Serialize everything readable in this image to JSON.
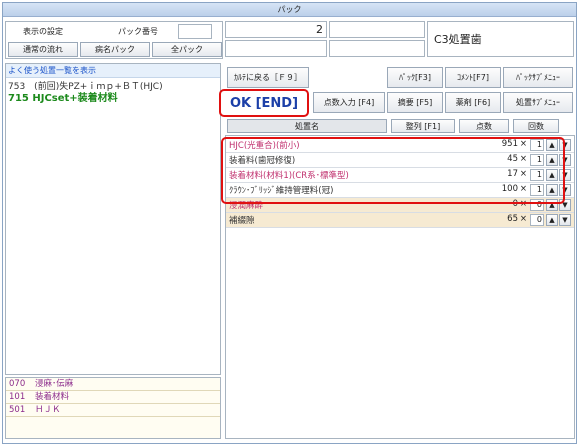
{
  "window": {
    "title": "パック"
  },
  "top_left": {
    "btn_display_settings": "表示の設定",
    "pack_number_label": "パック番号",
    "pack_number_value": "",
    "btn_normal_flow": "通常の流れ",
    "btn_disease_pack": "病名パック",
    "btn_all_pack": "全パック"
  },
  "top_right": {
    "count_value": "2",
    "pack_name": "C3処置歯"
  },
  "frequent_list": {
    "header": "よく使う処置一覧を表示",
    "items": [
      {
        "text": "753　(前回)失PZ+ｉｍｐ+ＢＴ(HJC)"
      },
      {
        "text": "715 HJCset+装着材料"
      }
    ]
  },
  "bottom_list": [
    {
      "code": "070",
      "name": "浸麻･伝麻"
    },
    {
      "code": "101",
      "name": "装着材料"
    },
    {
      "code": "501",
      "name": "ＨＪＫ"
    }
  ],
  "toolbar": {
    "return_chart": "ｶﾙﾃに戻る［Ｆ９］",
    "pack_f3": "ﾊﾟｯｸ[F3]",
    "comment_f7": "ｺﾒﾝﾄ[F7]",
    "pack_submenu": "ﾊﾟｯｸｻﾌﾞﾒﾆｭｰ",
    "ok_end": "OK [END]",
    "points_input": "点数入力 [F4]",
    "summary_f5": "摘要 [F5]",
    "drug_f6": "薬剤 [F6]",
    "procedure_submenu": "処置ｻﾌﾞﾒﾆｭｰ"
  },
  "table": {
    "col_name": "処置名",
    "col_sort": "整列 [F1]",
    "col_points": "点数",
    "col_times": "回数",
    "rows": [
      {
        "name": "HJC(光重合)(前小)",
        "points": "951",
        "x": "×",
        "qty": "1",
        "color": "pink"
      },
      {
        "name": "装着料(歯冠修復)",
        "points": "45",
        "x": "×",
        "qty": "1",
        "color": "dark"
      },
      {
        "name": "装着材料(材料1)(CR系･標準型)",
        "points": "17",
        "x": "×",
        "qty": "1",
        "color": "pink"
      },
      {
        "name": "ｸﾗｳﾝ･ﾌﾞﾘｯｼﾞ維持管理料(冠)",
        "points": "100",
        "x": "×",
        "qty": "1",
        "color": "dark"
      },
      {
        "name": "浸潤麻酔",
        "points": "0",
        "x": "×",
        "qty": "0",
        "color": "pink"
      },
      {
        "name": "補綴隙",
        "points": "65",
        "x": "×",
        "qty": "0",
        "color": "dark"
      }
    ],
    "up_glyph": "▲",
    "down_glyph": "▼"
  },
  "colors": {
    "highlight_border": "#e01010",
    "ok_text": "#1b3fa8",
    "frequent_green": "#1c8a1c"
  }
}
